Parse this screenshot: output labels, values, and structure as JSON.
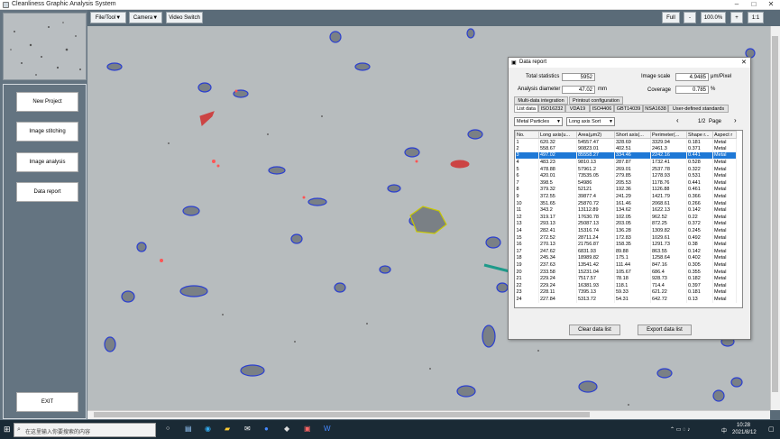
{
  "window": {
    "title": "Cleanliness Graphic Analysis System"
  },
  "left_nav": {
    "items": [
      "New Project",
      "Image stitching",
      "Image analysis",
      "Data report"
    ],
    "exit": "EXIT"
  },
  "toolbar": {
    "file_tool": "File/Tool▼",
    "camera": "Camera▼",
    "video_switch": "Video Switch",
    "full": "Full",
    "minus": "-",
    "zoom": "100.0%",
    "plus": "+",
    "ratio": "1:1"
  },
  "dialog": {
    "title": "Data report",
    "total_statistics_label": "Total statistics",
    "total_statistics": "5952",
    "image_scale_label": "Image scale",
    "image_scale": "4.9485",
    "image_scale_unit": "μm/Pixel",
    "analysis_diameter_label": "Analysis diameter",
    "analysis_diameter": "47.02",
    "analysis_diameter_unit": "mm",
    "coverage_label": "Coverage",
    "coverage": "0.785",
    "coverage_unit": "%",
    "tabs_row1": [
      "Multi-data integration",
      "Printout configuration"
    ],
    "tabs_row2": [
      "List data",
      "ISO16232",
      "VDA19",
      "ISO4406",
      "GBT14039",
      "NSA1638",
      "User-defined standards"
    ],
    "particle_type": "Metal Particles",
    "sort": "Long axis Sort",
    "page": "1/2",
    "page_label": "Page",
    "columns": [
      "No.",
      "Long axis(u...",
      "Area(μm2)",
      "Short axis(...",
      "Perimeter(...",
      "Shape r...",
      "Aspect r"
    ],
    "rows": [
      [
        "1",
        "620.32",
        "54557.47",
        "328.69",
        "3329.94",
        "0.181",
        "Metal"
      ],
      [
        "2",
        "558.67",
        "90823.01",
        "402.51",
        "2461.3",
        "0.371",
        "Metal"
      ],
      [
        "3",
        "497.02",
        "85558.27",
        "334.46",
        "2242.16",
        "0.441",
        "Metal"
      ],
      [
        "4",
        "483.23",
        "9810.13",
        "287.87",
        "1732.41",
        "0.528",
        "Metal"
      ],
      [
        "5",
        "478.88",
        "57961.2",
        "269.01",
        "2537.78",
        "0.322",
        "Metal"
      ],
      [
        "6",
        "420.01",
        "73535.05",
        "279.85",
        "1278.93",
        "0.531",
        "Metal"
      ],
      [
        "7",
        "398.5",
        "54986",
        "205.53",
        "1178.76",
        "0.441",
        "Metal"
      ],
      [
        "8",
        "379.32",
        "52121",
        "192.36",
        "1126.88",
        "0.461",
        "Metal"
      ],
      [
        "9",
        "372.55",
        "39877.4",
        "241.29",
        "1421.79",
        "0.366",
        "Metal"
      ],
      [
        "10",
        "351.65",
        "25870.72",
        "161.46",
        "2068.61",
        "0.266",
        "Metal"
      ],
      [
        "11",
        "343.2",
        "13112.89",
        "134.62",
        "1622.13",
        "0.142",
        "Metal"
      ],
      [
        "12",
        "319.17",
        "17630.78",
        "102.05",
        "962.52",
        "0.22",
        "Metal"
      ],
      [
        "13",
        "293.13",
        "25087.13",
        "203.05",
        "872.25",
        "0.372",
        "Metal"
      ],
      [
        "14",
        "282.41",
        "15316.74",
        "136.28",
        "1309.82",
        "0.245",
        "Metal"
      ],
      [
        "15",
        "272.52",
        "28711.24",
        "172.83",
        "1029.61",
        "0.492",
        "Metal"
      ],
      [
        "16",
        "270.13",
        "21756.87",
        "158.35",
        "1291.73",
        "0.38",
        "Metal"
      ],
      [
        "17",
        "247.62",
        "6831.93",
        "89.88",
        "863.55",
        "0.142",
        "Metal"
      ],
      [
        "18",
        "245.34",
        "18989.82",
        "175.1",
        "1258.64",
        "0.402",
        "Metal"
      ],
      [
        "19",
        "237.63",
        "13541.42",
        "111.44",
        "847.16",
        "0.305",
        "Metal"
      ],
      [
        "20",
        "233.58",
        "15231.04",
        "105.67",
        "686.4",
        "0.355",
        "Metal"
      ],
      [
        "21",
        "229.24",
        "7517.57",
        "78.18",
        "928.73",
        "0.182",
        "Metal"
      ],
      [
        "22",
        "229.24",
        "16381.93",
        "118.1",
        "714.4",
        "0.397",
        "Metal"
      ],
      [
        "23",
        "228.11",
        "7395.13",
        "59.33",
        "621.22",
        "0.181",
        "Metal"
      ],
      [
        "24",
        "227.84",
        "5313.72",
        "54.31",
        "642.72",
        "0.13",
        "Metal"
      ]
    ],
    "clear_button": "Clear data list",
    "export_button": "Export data list"
  },
  "taskbar": {
    "search_placeholder": "在这里输入你要搜索的内容",
    "time": "10:28",
    "date": "2021/8/12",
    "ime": "中"
  },
  "colors": {
    "panel": "#647481",
    "selection": "#1e78d6",
    "particle_outline": "#2b3fd0"
  }
}
